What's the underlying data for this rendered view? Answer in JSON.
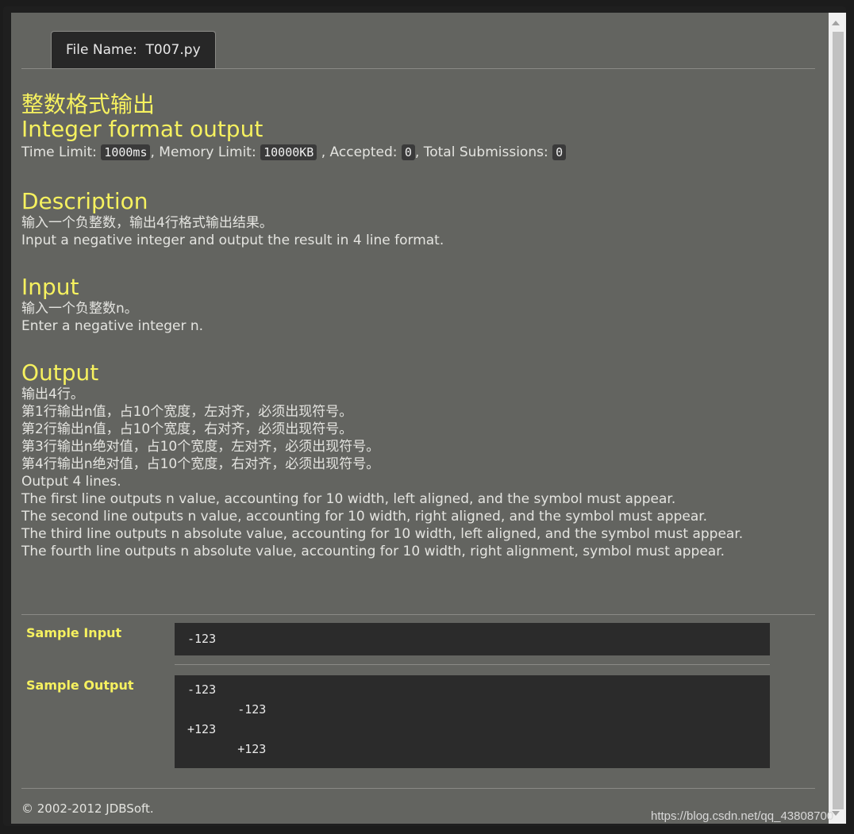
{
  "tab": {
    "label": "File Name:  T007.py"
  },
  "problem": {
    "title_cn": "整数格式输出",
    "title_en": "Integer format output",
    "meta": {
      "time_label": "Time Limit:",
      "time_value": "1000ms",
      "memory_label": ", Memory Limit:",
      "memory_value": "10000KB",
      "accepted_label": ", Accepted:",
      "accepted_value": "0",
      "total_label": ", Total Submissions:",
      "total_value": "0"
    }
  },
  "description": {
    "heading": "Description",
    "lines": [
      "输入一个负整数，输出4行格式输出结果。",
      "Input a negative integer and output the result in 4 line format."
    ]
  },
  "input": {
    "heading": "Input",
    "lines": [
      "输入一个负整数n。",
      "Enter a negative integer n."
    ]
  },
  "output": {
    "heading": "Output",
    "lines": [
      "输出4行。",
      "第1行输出n值，占10个宽度，左对齐，必须出现符号。",
      "第2行输出n值，占10个宽度，右对齐，必须出现符号。",
      "第3行输出n绝对值，占10个宽度，左对齐，必须出现符号。",
      "第4行输出n绝对值，占10个宽度，右对齐，必须出现符号。",
      "Output 4 lines.",
      "The first line outputs n value, accounting for 10 width, left aligned, and the symbol must appear.",
      "The second line outputs n value, accounting for 10 width, right aligned, and the symbol must appear.",
      "The third line outputs n absolute value, accounting for 10 width, left aligned, and the symbol must appear.",
      "The fourth line outputs n absolute value, accounting for 10 width, right alignment, symbol must appear."
    ]
  },
  "samples": {
    "input_label": "Sample Input",
    "input_text": "-123",
    "output_label": "Sample Output",
    "output_text": "-123\n       -123\n+123\n       +123"
  },
  "footer": {
    "text": "© 2002-2012  JDBSoft."
  },
  "watermark": {
    "text": "https://blog.csdn.net/qq_43808700"
  }
}
